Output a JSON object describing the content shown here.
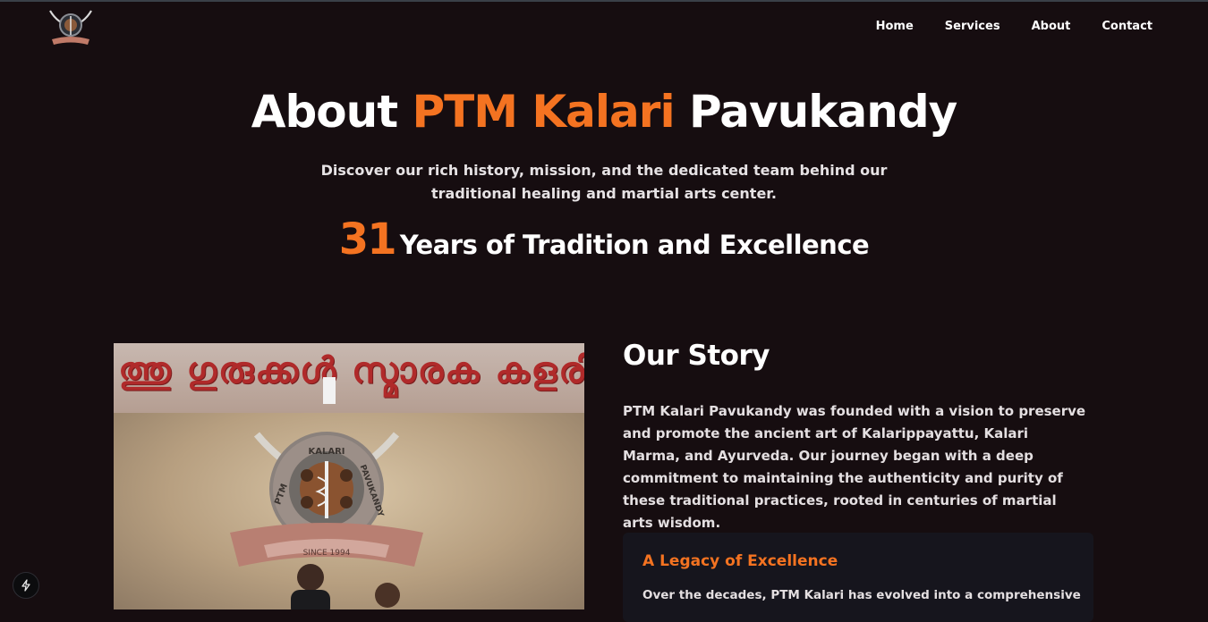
{
  "header": {
    "logo_icon": "kalari-emblem-icon",
    "nav": [
      {
        "label": "Home"
      },
      {
        "label": "Services"
      },
      {
        "label": "About"
      },
      {
        "label": "Contact"
      }
    ]
  },
  "hero": {
    "title_prefix": "About ",
    "title_accent": "PTM Kalari",
    "title_suffix": " Pavukandy",
    "subtitle": "Discover our rich history, mission, and the dedicated team behind our traditional healing and martial arts center.",
    "years_number": "31",
    "years_text": "Years of Tradition and Excellence"
  },
  "story": {
    "title": "Our Story",
    "text": "PTM Kalari Pavukandy was founded with a vision to preserve and promote the ancient art of Kalarippayattu, Kalari Marma, and Ayurveda. Our journey began with a deep commitment to maintaining the authenticity and purity of these traditional practices, rooted in centuries of martial arts wisdom.",
    "photo": {
      "banner_text": "ത്തു ഗുരുക്കൾ സ്മാരക കളരി",
      "emblem_top": "KALARI",
      "emblem_left": "PTM",
      "emblem_right": "PAVUKANDY",
      "since": "SINCE 1994"
    },
    "legacy": {
      "title": "A Legacy of Excellence",
      "text": "Over the decades, PTM Kalari has evolved into a comprehensive"
    }
  },
  "colors": {
    "background": "#160d10",
    "accent": "#f47321",
    "card": "#16151d"
  },
  "fab_icon": "lightning-icon"
}
